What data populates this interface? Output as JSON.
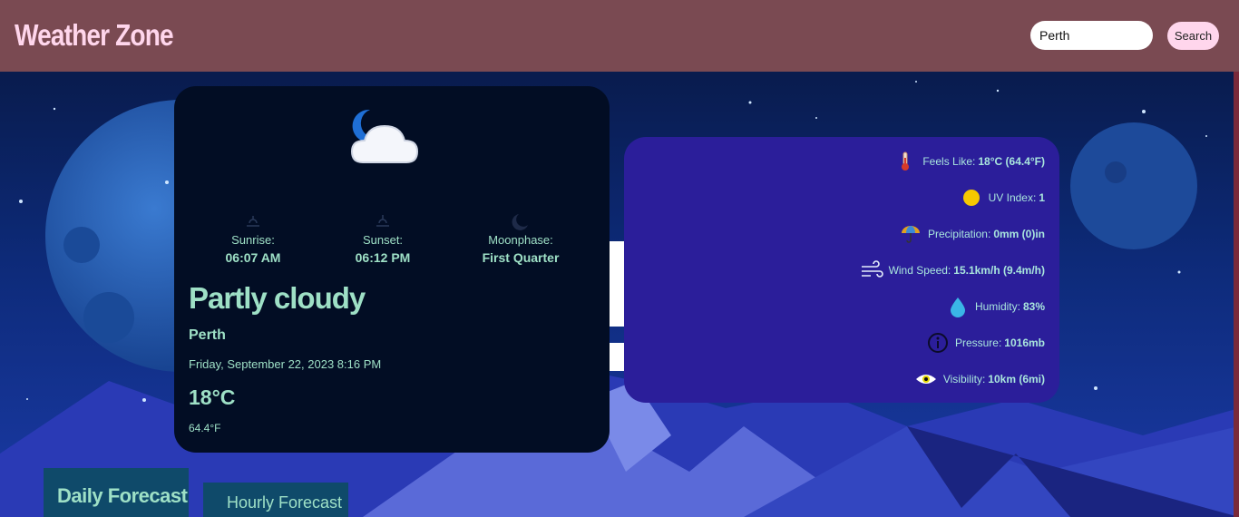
{
  "header": {
    "brand": "Weather Zone",
    "search_value": "Perth",
    "search_button": "Search"
  },
  "current": {
    "icon": "moon-cloud-icon",
    "sunrise_label": "Sunrise:",
    "sunrise_value": "06:07 AM",
    "sunset_label": "Sunset:",
    "sunset_value": "06:12 PM",
    "moonphase_label": "Moonphase:",
    "moonphase_value": "First Quarter",
    "condition": "Partly cloudy",
    "city": "Perth",
    "datetime": "Friday, September 22, 2023 8:16 PM",
    "temp_c": "18°C",
    "temp_f": "64.4°F"
  },
  "details": [
    {
      "icon": "thermometer-icon",
      "label": "Feels Like:",
      "value": "18°C (64.4°F)"
    },
    {
      "icon": "sun-icon",
      "label": "UV Index:",
      "value": "1"
    },
    {
      "icon": "umbrella-icon",
      "label": "Precipitation:",
      "value": "0mm (0)in"
    },
    {
      "icon": "wind-icon",
      "label": "Wind Speed:",
      "value": "15.1km/h (9.4m/h)"
    },
    {
      "icon": "droplet-icon",
      "label": "Humidity:",
      "value": "83%"
    },
    {
      "icon": "gauge-icon",
      "label": "Pressure:",
      "value": "1016mb"
    },
    {
      "icon": "eye-icon",
      "label": "Visibility:",
      "value": "10km (6mi)"
    }
  ],
  "tabs": {
    "daily": "Daily Forecast",
    "hourly": "Hourly Forecast"
  },
  "colors": {
    "header": "#7a4a52",
    "brand_text": "#ffd6ec",
    "main_card": "#020d24",
    "detail_card": "#2b1e9a",
    "accent_text": "#9ee0c6",
    "tab_bg": "#0f4a6a"
  }
}
